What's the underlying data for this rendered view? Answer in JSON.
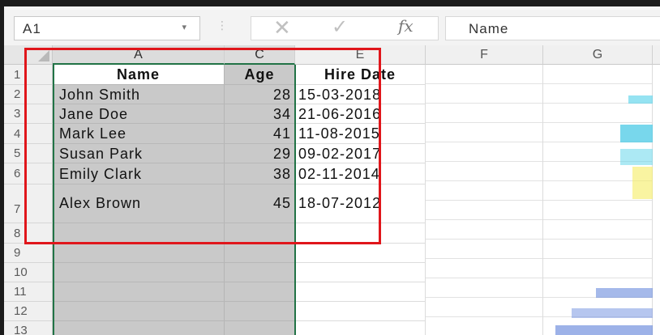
{
  "formula_bar": {
    "name_box": "A1",
    "dropdown_icon": "chevron-down-icon",
    "cancel_icon": "close-icon",
    "enter_icon": "checkmark-icon",
    "fx_label": "fx",
    "value": "Name"
  },
  "columns": [
    "A",
    "C",
    "E",
    "F",
    "G"
  ],
  "rows": [
    "1",
    "2",
    "3",
    "4",
    "5",
    "6",
    "7",
    "8",
    "9",
    "10",
    "11",
    "12",
    "13"
  ],
  "table": {
    "headers": [
      "Name",
      "Age",
      "Hire Date"
    ],
    "records": [
      {
        "name": "John Smith",
        "age": "28",
        "date": "15-03-2018"
      },
      {
        "name": "Jane Doe",
        "age": "34",
        "date": "21-06-2016"
      },
      {
        "name": "Mark Lee",
        "age": "41",
        "date": "11-08-2015"
      },
      {
        "name": "Susan Park",
        "age": "29",
        "date": "09-02-2017"
      },
      {
        "name": "Emily Clark",
        "age": "38",
        "date": "02-11-2014"
      },
      {
        "name": "Alex Brown",
        "age": "45",
        "date": "18-07-2012"
      }
    ]
  },
  "colors": {
    "selection": "#217346",
    "highlight_box": "#e0161b",
    "selected_fill": "#c9c9c9"
  }
}
